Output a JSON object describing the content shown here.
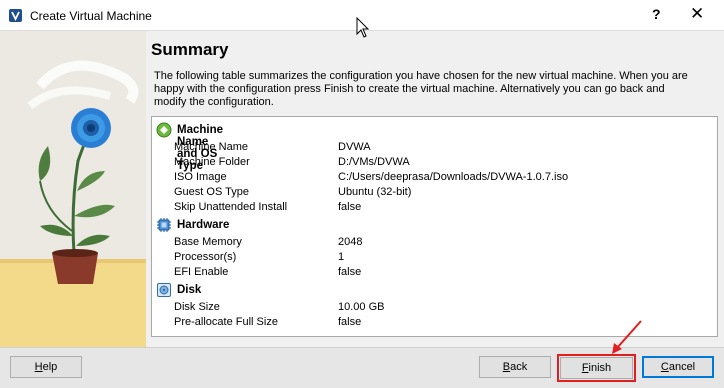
{
  "window": {
    "title": "Create Virtual Machine",
    "help_glyph": "?",
    "close_glyph": "✕"
  },
  "page": {
    "title": "Summary",
    "description": "The following table summarizes the configuration you have chosen for the new virtual machine. When you are happy with the configuration press Finish to create the virtual machine. Alternatively you can go back and modify the configuration."
  },
  "sections": [
    {
      "title": "Machine Name and OS Type",
      "icon": "os-type-icon",
      "rows": [
        {
          "key": "Machine Name",
          "value": "DVWA"
        },
        {
          "key": "Machine Folder",
          "value": "D:/VMs/DVWA"
        },
        {
          "key": "ISO Image",
          "value": "C:/Users/deeprasa/Downloads/DVWA-1.0.7.iso"
        },
        {
          "key": "Guest OS Type",
          "value": "Ubuntu (32-bit)"
        },
        {
          "key": "Skip Unattended Install",
          "value": "false"
        }
      ]
    },
    {
      "title": "Hardware",
      "icon": "chip-icon",
      "rows": [
        {
          "key": "Base Memory",
          "value": "2048"
        },
        {
          "key": "Processor(s)",
          "value": "1"
        },
        {
          "key": "EFI Enable",
          "value": "false"
        }
      ]
    },
    {
      "title": "Disk",
      "icon": "disk-icon",
      "rows": [
        {
          "key": "Disk Size",
          "value": "10.00 GB"
        },
        {
          "key": "Pre-allocate Full Size",
          "value": "false"
        }
      ]
    }
  ],
  "buttons": {
    "help": {
      "pre": "",
      "mnemonic": "H",
      "post": "elp"
    },
    "back": {
      "pre": "",
      "mnemonic": "B",
      "post": "ack"
    },
    "finish": {
      "pre": "",
      "mnemonic": "F",
      "post": "inish"
    },
    "cancel": {
      "pre": "",
      "mnemonic": "C",
      "post": "ancel"
    }
  },
  "colors": {
    "accent": "#0078d7",
    "highlight": "#e02020",
    "flower": "#2a7fd4"
  }
}
